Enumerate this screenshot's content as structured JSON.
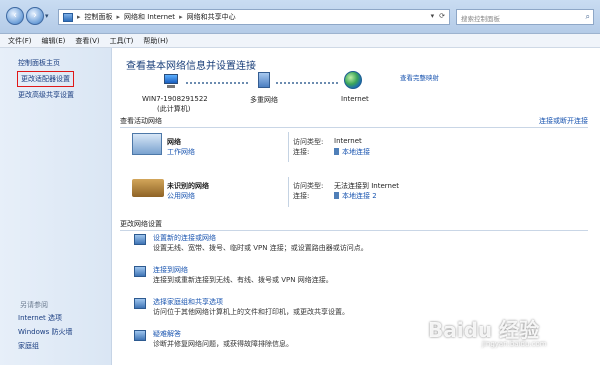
{
  "address_bar": {
    "crumbs": [
      "控制面板",
      "网络和 Internet",
      "网络和共享中心"
    ],
    "separator": "▸"
  },
  "search": {
    "placeholder": "搜索控制面板"
  },
  "menu": [
    "文件(F)",
    "编辑(E)",
    "查看(V)",
    "工具(T)",
    "帮助(H)"
  ],
  "sidebar": {
    "items": [
      "控制面板主页",
      "更改适配器设置",
      "更改高级共享设置"
    ],
    "see_also_header": "另请参阅",
    "see_also": [
      "Internet 选项",
      "Windows 防火墙",
      "家庭组"
    ]
  },
  "main": {
    "title": "查看基本网络信息并设置连接",
    "full_map_link": "查看完整映射",
    "map": {
      "computer_name": "WIN7-1908291522",
      "computer_sub": "(此计算机)",
      "network": "多重网络",
      "internet": "Internet"
    },
    "active_header": "查看活动网络",
    "connect_disconnect": "连接或断开连接",
    "networks": [
      {
        "name": "网络",
        "type": "工作网络",
        "access_label": "访问类型:",
        "access_value": "Internet",
        "conn_label": "连接:",
        "conn_value": "本地连接"
      },
      {
        "name": "未识别的网络",
        "type": "公用网络",
        "access_label": "访问类型:",
        "access_value": "无法连接到 Internet",
        "conn_label": "连接:",
        "conn_value": "本地连接 2"
      }
    ],
    "change_header": "更改网络设置",
    "tasks": [
      {
        "title": "设置新的连接或网络",
        "desc": "设置无线、宽带、拨号、临时或 VPN 连接；或设置路由器或访问点。"
      },
      {
        "title": "连接到网络",
        "desc": "连接到或重新连接到无线、有线、拨号或 VPN 网络连接。"
      },
      {
        "title": "选择家庭组和共享选项",
        "desc": "访问位于其他网络计算机上的文件和打印机，或更改共享设置。"
      },
      {
        "title": "疑难解答",
        "desc": "诊断并修复网络问题，或获得故障排除信息。"
      }
    ]
  },
  "watermark": {
    "text": "Baidu 经验",
    "url": "jingyan.baidu.com"
  }
}
